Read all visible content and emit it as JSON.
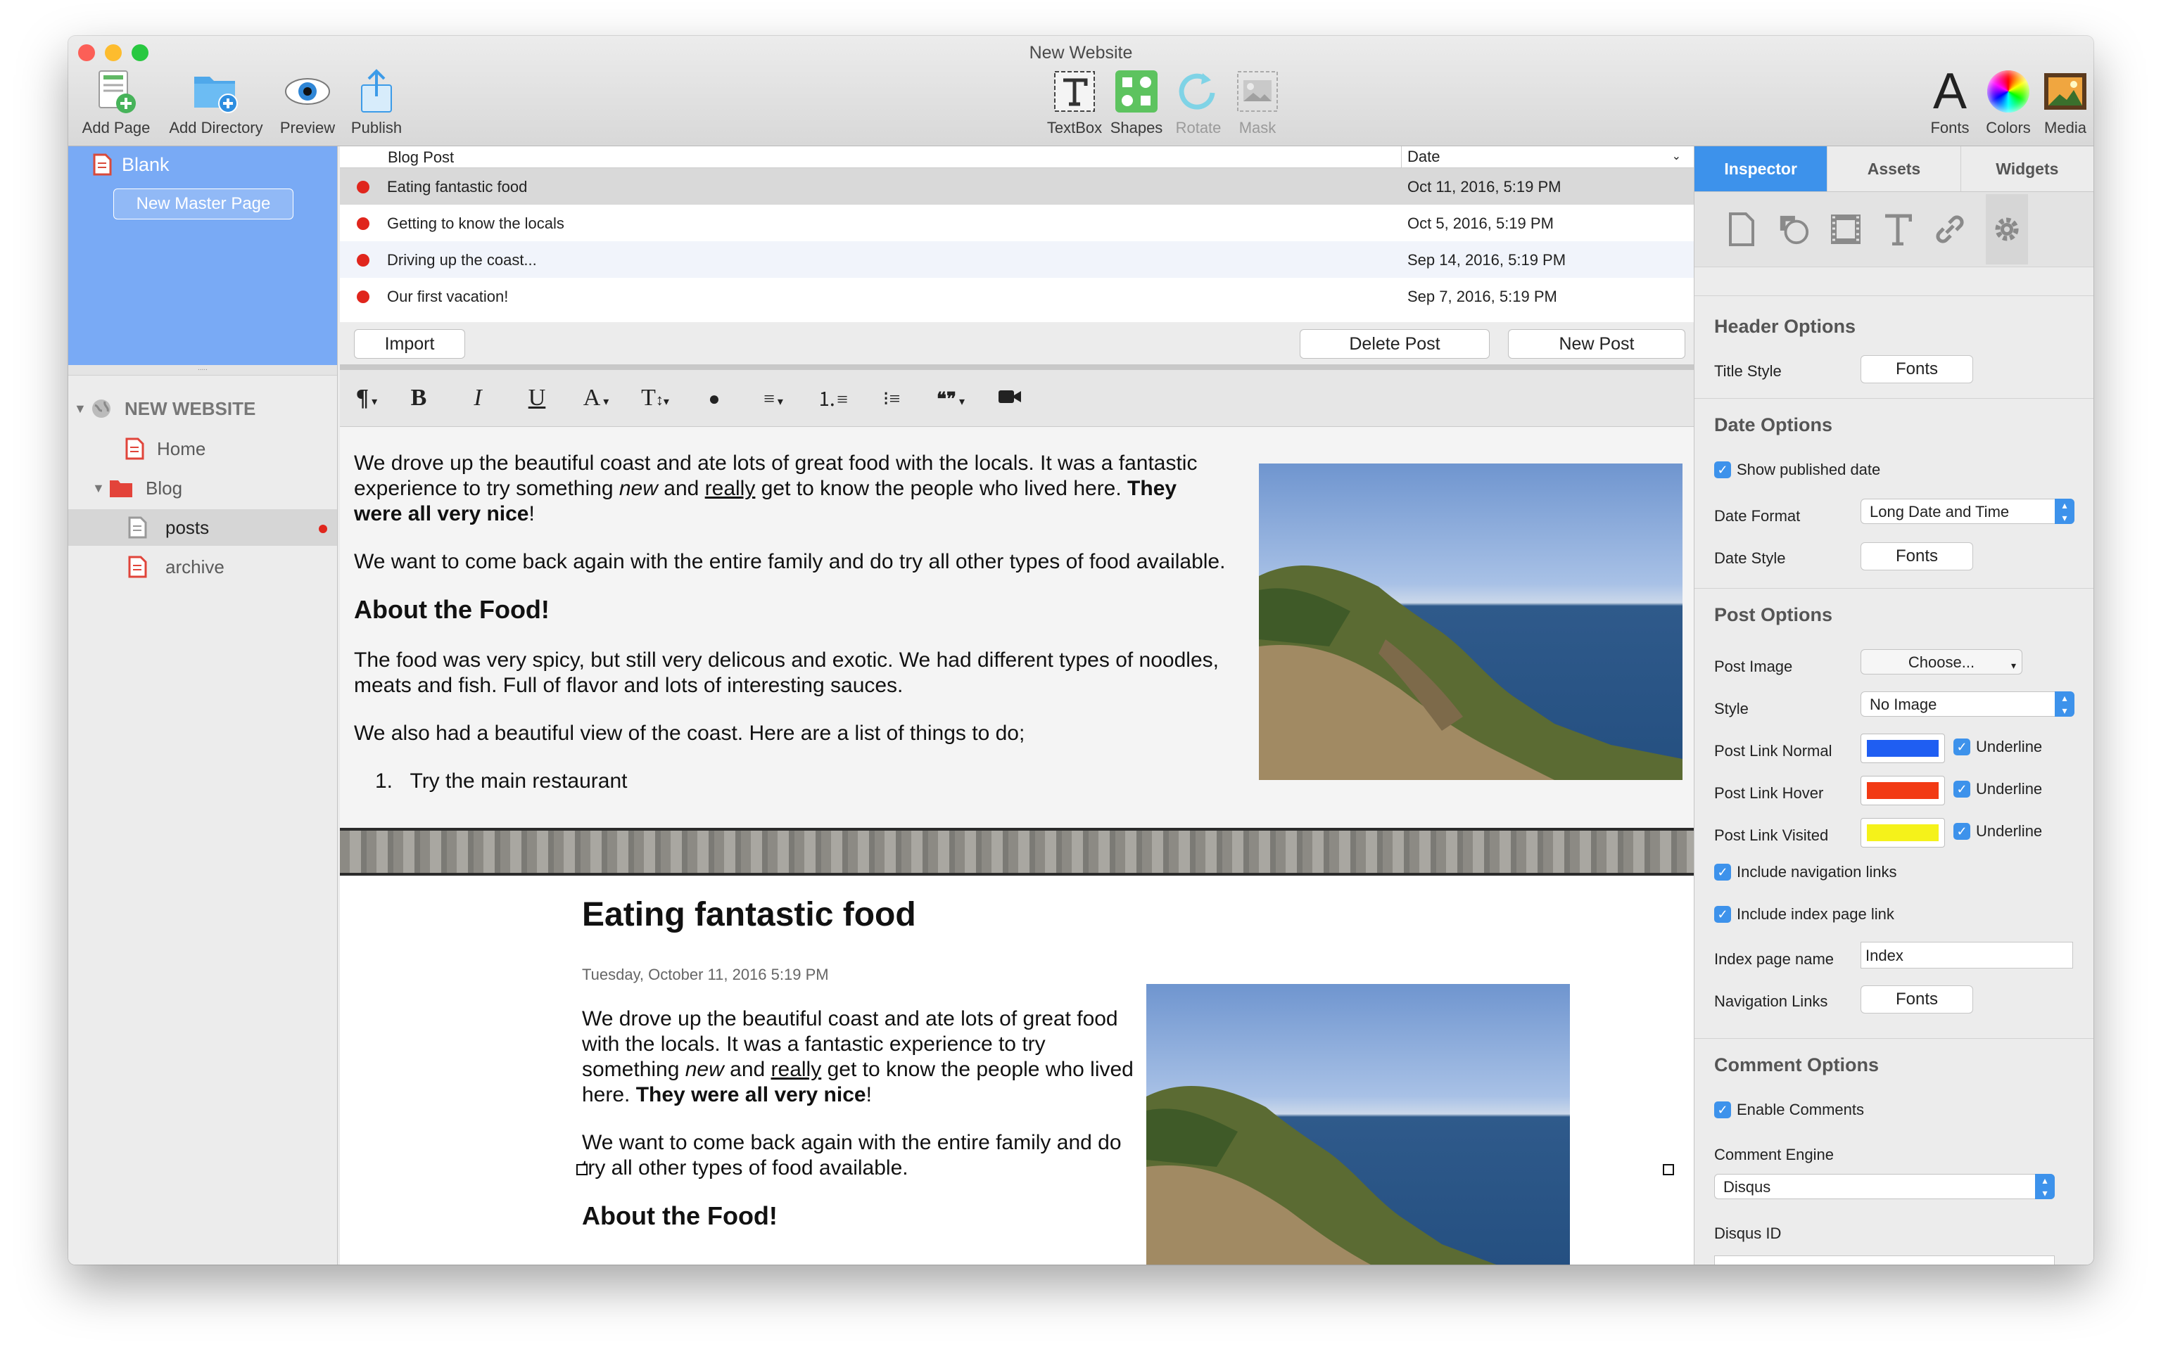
{
  "window": {
    "title": "New Website"
  },
  "toolbar": {
    "left": [
      "Add Page",
      "Add Directory",
      "Preview",
      "Publish"
    ],
    "center": [
      "TextBox",
      "Shapes",
      "Rotate",
      "Mask"
    ],
    "right": [
      "Fonts",
      "Colors",
      "Media"
    ]
  },
  "sidebar": {
    "master_page": "Blank",
    "new_master_button": "New Master Page",
    "site_name": "NEW WEBSITE",
    "pages": [
      "Home",
      "Blog",
      "posts",
      "archive"
    ]
  },
  "post_list": {
    "columns": [
      "Blog Post",
      "Date"
    ],
    "rows": [
      {
        "title": "Eating fantastic food",
        "date": "Oct 11, 2016, 5:19 PM"
      },
      {
        "title": "Getting to know the locals",
        "date": "Oct 5, 2016, 5:19 PM"
      },
      {
        "title": "Driving up the coast...",
        "date": "Sep 14, 2016, 5:19 PM"
      },
      {
        "title": "Our first vacation!",
        "date": "Sep 7, 2016, 5:19 PM"
      }
    ],
    "import_button": "Import",
    "delete_button": "Delete Post",
    "new_button": "New Post"
  },
  "format_bar": {
    "paragraph": "¶",
    "bold": "B",
    "italic": "I",
    "underline": "U",
    "font": "A",
    "size": "T",
    "quote": "❝❞"
  },
  "editor": {
    "p1_a": "We drove up the beautiful coast and ate lots of great food with the locals. It was a fantastic experience to try something ",
    "p1_new": "new",
    "p1_and": " and ",
    "p1_really": "really",
    "p1_b": " get to know the people who lived here. ",
    "p1_bold": "They were all very nice",
    "p1_end": "!",
    "p2": "We want to come back again with the entire family and do try all other types of food available.",
    "heading": "About the Food!",
    "p3": "The food was very spicy, but still very delicous and exotic. We had different types of noodles, meats and fish. Full of flavor and lots of interesting sauces.",
    "p4": "We also had a beautiful view of the coast. Here are a list of things to do;",
    "li1": "Try the main restaurant"
  },
  "preview": {
    "title": "Eating fantastic food",
    "date": "Tuesday, October 11, 2016 5:19 PM"
  },
  "inspector": {
    "tabs": [
      "Inspector",
      "Assets",
      "Widgets"
    ],
    "header_options": "Header Options",
    "title_style": "Title Style",
    "fonts": "Fonts",
    "date_options": "Date Options",
    "show_published_date": "Show published date",
    "date_format": "Date Format",
    "date_format_value": "Long Date and Time",
    "date_style": "Date Style",
    "post_options": "Post Options",
    "post_image": "Post Image",
    "choose": "Choose...",
    "style": "Style",
    "style_value": "No Image",
    "link_normal": "Post Link Normal",
    "link_hover": "Post Link Hover",
    "link_visited": "Post Link Visited",
    "underline": "Underline",
    "colors": {
      "normal": "#1f5ef2",
      "hover": "#f23a14",
      "visited": "#f5f21a"
    },
    "include_nav": "Include navigation links",
    "include_index": "Include index page link",
    "index_page_name": "Index page name",
    "index_value": "Index",
    "navigation_links": "Navigation Links",
    "comment_options": "Comment Options",
    "enable_comments": "Enable Comments",
    "comment_engine": "Comment Engine",
    "engine_value": "Disqus",
    "disqus_id": "Disqus ID"
  }
}
